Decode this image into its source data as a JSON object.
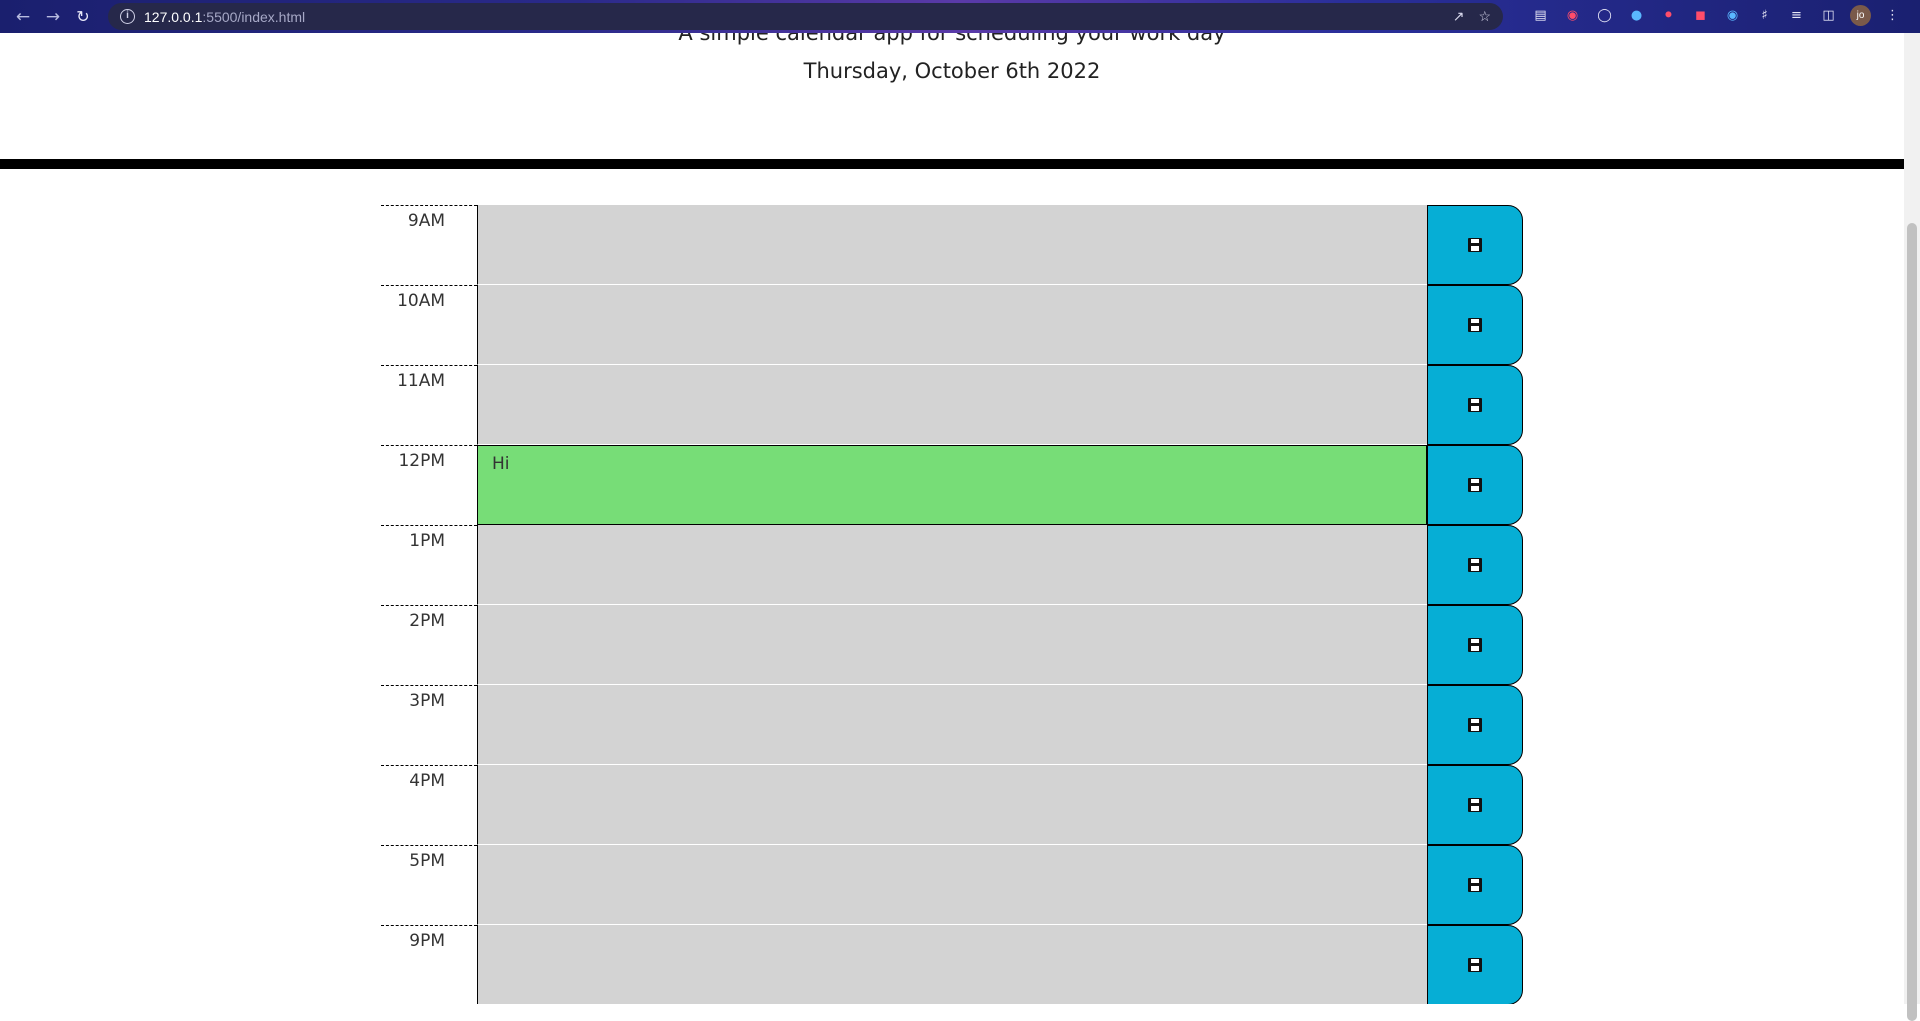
{
  "browser": {
    "url_host": "127.0.0.1",
    "url_path": ":5500/index.html",
    "avatar_initials": "jo",
    "extensions": [
      "apps-icon",
      "pocket-icon",
      "github-icon",
      "extension-icon",
      "stop-icon",
      "extension-icon",
      "shazam-icon",
      "puzzle-icon",
      "reading-list-icon",
      "side-panel-icon"
    ]
  },
  "header": {
    "lead": "A simple calendar app for scheduling your work day",
    "current_day": "Thursday, October 6th 2022"
  },
  "schedule": [
    {
      "hour": "9AM",
      "text": "",
      "state": "past"
    },
    {
      "hour": "10AM",
      "text": "",
      "state": "past"
    },
    {
      "hour": "11AM",
      "text": "",
      "state": "past"
    },
    {
      "hour": "12PM",
      "text": "Hi",
      "state": "present"
    },
    {
      "hour": "1PM",
      "text": "",
      "state": "past"
    },
    {
      "hour": "2PM",
      "text": "",
      "state": "past"
    },
    {
      "hour": "3PM",
      "text": "",
      "state": "past"
    },
    {
      "hour": "4PM",
      "text": "",
      "state": "past"
    },
    {
      "hour": "5PM",
      "text": "",
      "state": "past"
    },
    {
      "hour": "9PM",
      "text": "",
      "state": "past"
    }
  ],
  "colors": {
    "past": "#d3d3d3",
    "present": "#77dd77",
    "save_button": "#06aed5"
  }
}
